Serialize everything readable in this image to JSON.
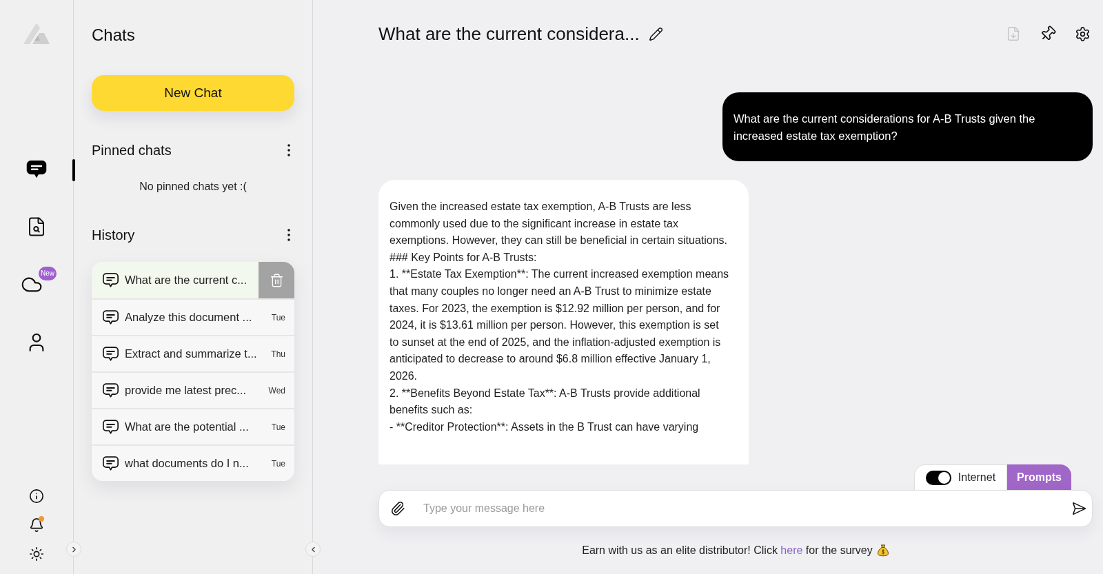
{
  "rail": {
    "items": [
      {
        "kind": "chat",
        "selected": true
      },
      {
        "kind": "document-search",
        "selected": false
      },
      {
        "kind": "cloud",
        "selected": false,
        "badge": "New"
      },
      {
        "kind": "person",
        "selected": false
      }
    ],
    "bottom_items": [
      {
        "kind": "info",
        "notification": false
      },
      {
        "kind": "bell",
        "notification": true
      },
      {
        "kind": "theme",
        "notification": false
      }
    ]
  },
  "sidebar": {
    "title": "Chats",
    "new_chat_button": "New Chat",
    "pinned": {
      "title": "Pinned chats",
      "empty_text": "No pinned chats yet :("
    },
    "history": {
      "title": "History",
      "items": [
        {
          "title": "What are the current c...",
          "selected": true
        },
        {
          "title": "Analyze this document ...",
          "day": "Tue",
          "selected": false
        },
        {
          "title": "Extract and summarize t...",
          "day": "Thu",
          "selected": false
        },
        {
          "title": "provide me latest prec...",
          "day": "Wed",
          "selected": false
        },
        {
          "title": "What are the potential ...",
          "day": "Tue",
          "selected": false
        },
        {
          "title": "what documents do I n...",
          "day": "Tue",
          "selected": false
        }
      ]
    }
  },
  "chat": {
    "title": "What are the current considera...",
    "header_actions": [
      {
        "kind": "download",
        "disabled": true
      },
      {
        "kind": "pin",
        "disabled": false
      },
      {
        "kind": "settings",
        "disabled": false
      }
    ],
    "messages": [
      {
        "kind": "user",
        "paragraphs": [
          "What are the current considerations for A-B Trusts given the increased estate tax exemption?"
        ]
      },
      {
        "kind": "assistant",
        "paragraphs": [
          "Given the increased estate tax exemption, A-B Trusts are less commonly used due to the significant increase in estate tax exemptions. However, they can still be beneficial in certain situations.",
          "### Key Points for A-B Trusts:",
          "1. **Estate Tax Exemption**: The current increased exemption means that many couples no longer need an A-B Trust to minimize estate taxes. For 2023, the exemption is $12.92 million per person, and for 2024, it is $13.61 million per person. However, this exemption is set to sunset at the end of 2025, and the inflation-adjusted exemption is anticipated to decrease to around $6.8 million effective January 1, 2026.",
          "2. **Benefits Beyond Estate Tax**: A-B Trusts provide additional benefits such as:",
          "- **Creditor Protection**: Assets in the B Trust can have varying"
        ]
      }
    ],
    "composer": {
      "internet": {
        "label": "Internet",
        "on": true
      },
      "prompts_button": "Prompts",
      "placeholder": "Type your message here"
    },
    "footer": {
      "text_before": "Earn with us as an elite distributor! Click",
      "link": "here",
      "text_after": "for the survey"
    }
  }
}
